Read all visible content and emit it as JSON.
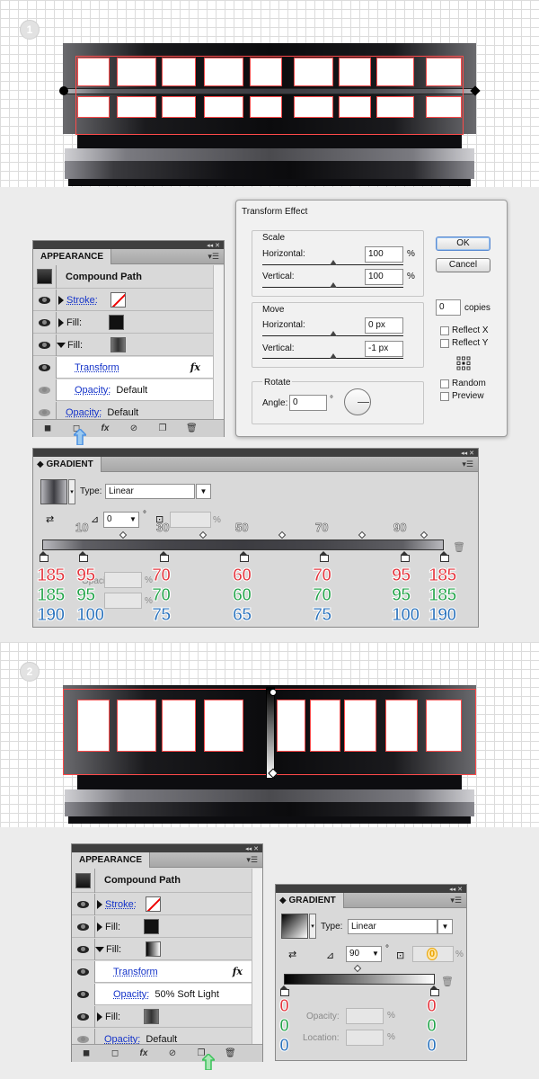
{
  "steps": [
    "1",
    "2"
  ],
  "appearance1": {
    "tab": "APPEARANCE",
    "object": "Compound Path",
    "stroke_label": "Stroke:",
    "fill_label": "Fill:",
    "fill2_label": "Fill:",
    "transform_label": "Transform",
    "fx": "fx",
    "opacity_inner_label": "Opacity:",
    "opacity_inner_value": "Default",
    "opacity_label": "Opacity:",
    "opacity_value": "Default"
  },
  "transform_effect": {
    "title": "Transform Effect",
    "scale": "Scale",
    "horizontal": "Horizontal:",
    "horizontal_value": "100",
    "vertical": "Vertical:",
    "vertical_value": "100",
    "percent": "%",
    "move": "Move",
    "move_h": "Horizontal:",
    "move_h_value": "0 px",
    "move_v": "Vertical:",
    "move_v_value": "-1 px",
    "rotate": "Rotate",
    "angle": "Angle:",
    "angle_value": "0",
    "degree": "°",
    "ok": "OK",
    "cancel": "Cancel",
    "copies_value": "0",
    "copies": "copies",
    "reflect_x": "Reflect X",
    "reflect_y": "Reflect Y",
    "random": "Random",
    "preview": "Preview"
  },
  "gradient1": {
    "tab": "GRADIENT",
    "type_label": "Type:",
    "type_value": "Linear",
    "angle_value": "0",
    "degree": "°",
    "percent": "%",
    "locations": [
      "10",
      "30",
      "50",
      "70",
      "90"
    ],
    "red": [
      "185",
      "95",
      "70",
      "60",
      "70",
      "95",
      "185"
    ],
    "green": [
      "185",
      "95",
      "70",
      "60",
      "70",
      "95",
      "185"
    ],
    "blue": [
      "190",
      "100",
      "75",
      "65",
      "75",
      "100",
      "190"
    ]
  },
  "appearance2": {
    "tab": "APPEARANCE",
    "object": "Compound Path",
    "stroke_label": "Stroke:",
    "fill_label": "Fill:",
    "fill2_label": "Fill:",
    "transform_label": "Transform",
    "fx": "fx",
    "opacity_inner_label": "Opacity:",
    "opacity_inner_value": "50% Soft Light",
    "fill3_label": "Fill:",
    "opacity_label": "Opacity:",
    "opacity_value": "Default"
  },
  "gradient2": {
    "tab": "GRADIENT",
    "type_label": "Type:",
    "type_value": "Linear",
    "angle_value": "90",
    "degree": "°",
    "percent": "%",
    "highlight_value": "0",
    "opacity_label": "Opacity:",
    "location_label": "Location:",
    "left_rgb": [
      "0",
      "0",
      "0"
    ],
    "right_rgb": [
      "0",
      "0",
      "0"
    ]
  },
  "colors": {
    "accent_red": "#e4343d",
    "accent_green": "#23a44a",
    "accent_blue": "#2b73bd",
    "arrow_blue": "#4a90e2",
    "arrow_green": "#3ac25a"
  }
}
